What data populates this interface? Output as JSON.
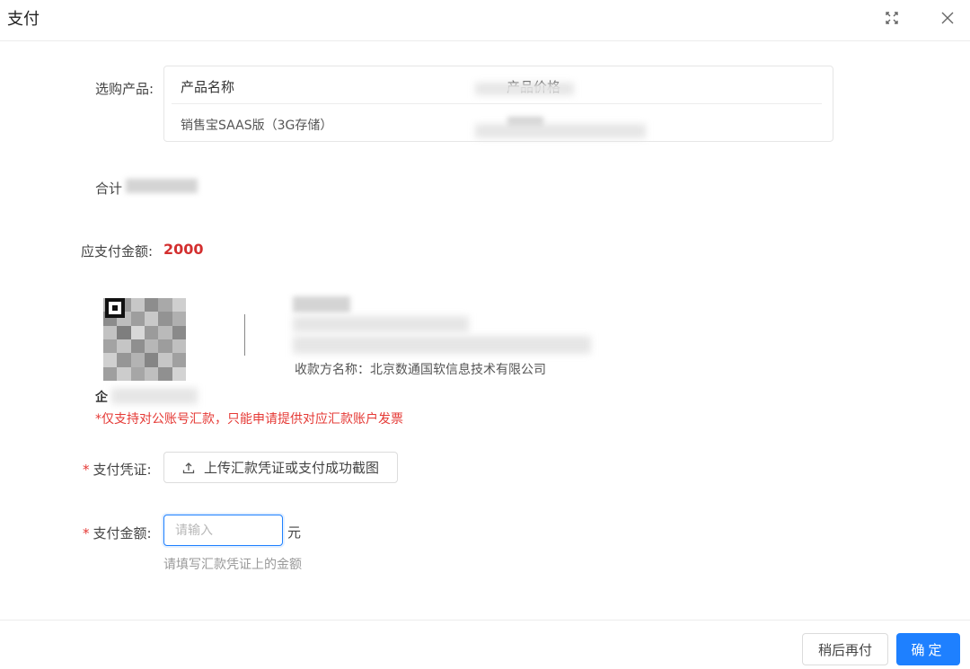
{
  "dialog": {
    "title": "支付",
    "icons": {
      "fullscreen": "fullscreen-icon",
      "close": "close-icon"
    }
  },
  "product": {
    "label": "选购产品:",
    "columns": [
      "产品名称",
      "产品价格"
    ],
    "rows": [
      {
        "name": "销售宝SAAS版（3G存储）"
      }
    ]
  },
  "total": {
    "label": "合计"
  },
  "payable": {
    "label": "应支付金额:",
    "value": "2000"
  },
  "payment_info": {
    "payee": "收款方名称：北京数通国软信息技术有限公司",
    "qr_caption": "企",
    "notice": "*仅支持对公账号汇款，只能申请提供对应汇款账户发票"
  },
  "voucher": {
    "label": "支付凭证:",
    "upload_label": "上传汇款凭证或支付成功截图",
    "icon": "upload-icon"
  },
  "pay_amount": {
    "label": "支付金额:",
    "placeholder": "请输入",
    "unit": "元",
    "hint": "请填写汇款凭证上的金额"
  },
  "footer": {
    "later": "稍后再付",
    "confirm": "确定"
  },
  "colors": {
    "primary": "#1e80ff",
    "danger": "#d32f2f",
    "required": "#e53935"
  }
}
